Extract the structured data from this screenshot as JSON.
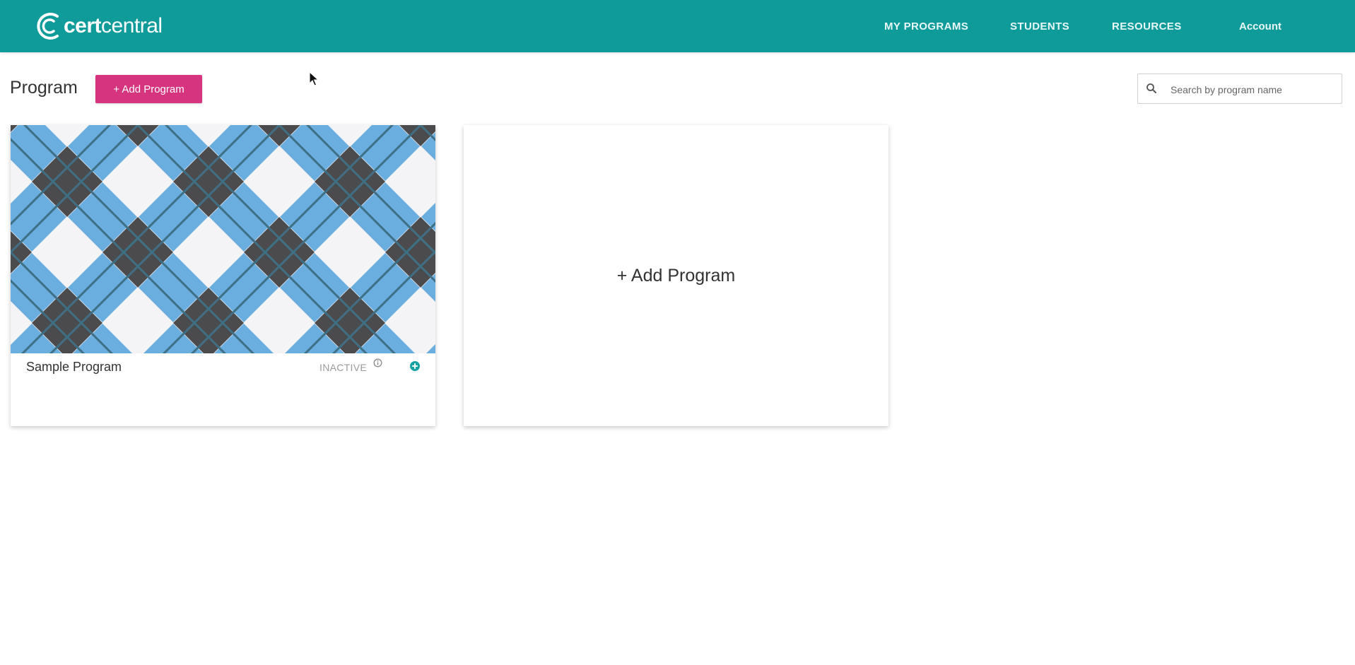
{
  "app": {
    "logo_word_bold": "cert",
    "logo_word_light": "central",
    "colors": {
      "header": "#0f9b9a",
      "accent_button": "#d6347f",
      "plaid_dark": "#4b4a4c",
      "plaid_blue": "#6aaee0"
    }
  },
  "nav": {
    "items": [
      {
        "label": "MY PROGRAMS"
      },
      {
        "label": "STUDENTS"
      },
      {
        "label": "RESOURCES"
      },
      {
        "label": "Account"
      }
    ]
  },
  "page": {
    "title": "Program",
    "add_button_label": "+ Add Program"
  },
  "search": {
    "placeholder": "Search by program name",
    "icon": "search-icon"
  },
  "programs": [
    {
      "name": "Sample Program",
      "status": "INACTIVE",
      "status_icon": "info-icon",
      "action_icon": "plus-circle-icon"
    }
  ],
  "add_card": {
    "label": "+ Add Program"
  }
}
